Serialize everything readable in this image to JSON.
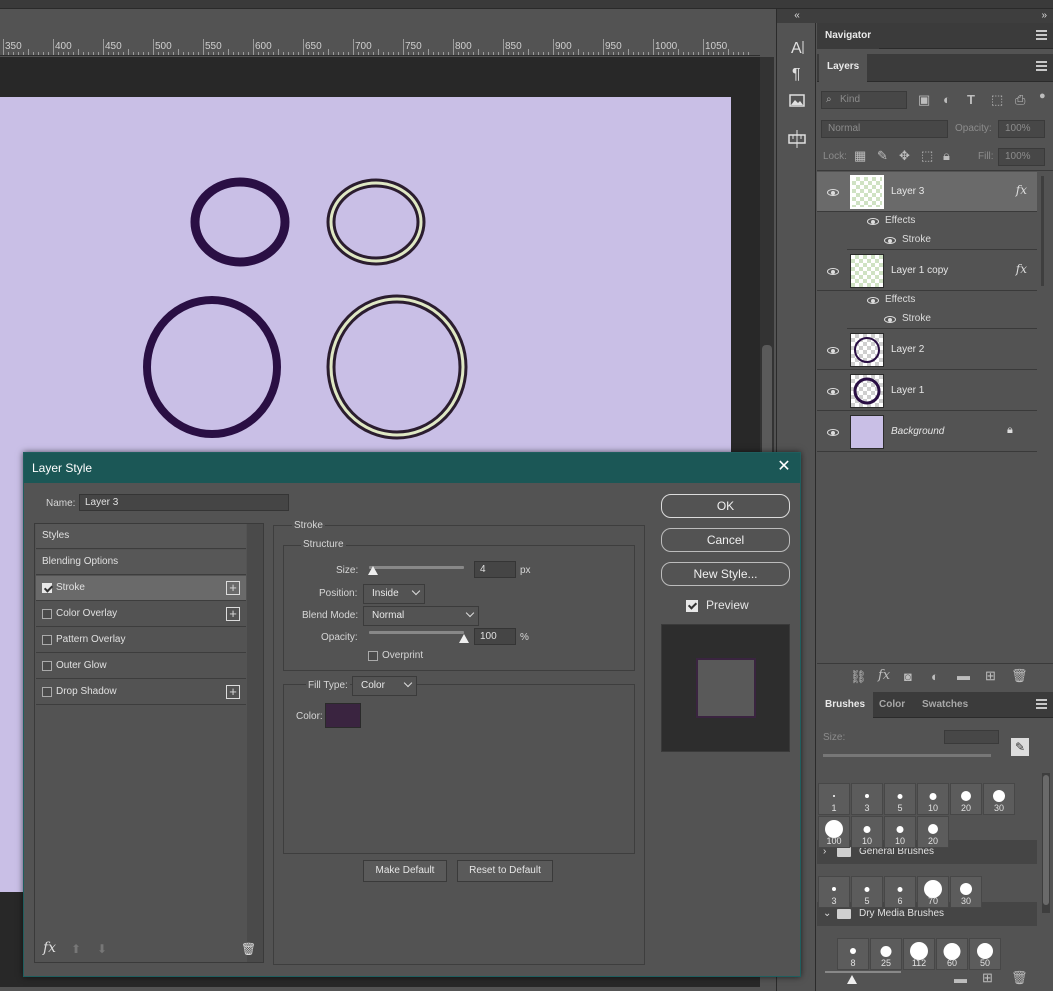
{
  "ruler": {
    "labels": [
      "350",
      "400",
      "450",
      "500",
      "550",
      "600",
      "650",
      "700",
      "750",
      "800",
      "850",
      "900",
      "950",
      "1000",
      "1050"
    ]
  },
  "colors": {
    "canvas": "#c9bfe6",
    "ring_dark": "#2a0f44",
    "ring_light": "#dfe8c4",
    "stroke_color": "#3a2440",
    "dialog_title": "#1b5756"
  },
  "toolbar": {
    "collapse": "«",
    "tools": [
      "character-icon",
      "paragraph-icon",
      "image-icon",
      "measure-icon"
    ]
  },
  "panels": {
    "collapse": "»",
    "navigator_tab": "Navigator",
    "layers_tab": "Layers",
    "filter_kind": "Kind",
    "blend_mode": "Normal",
    "opacity_label": "Opacity:",
    "opacity_value": "100%",
    "lock_label": "Lock:",
    "fill_label": "Fill:",
    "fill_value": "100%"
  },
  "layers": [
    {
      "name": "Layer 3",
      "fx": "fx",
      "effects_label": "Effects",
      "effect": "Stroke",
      "selected": true
    },
    {
      "name": "Layer 1 copy",
      "fx": "fx",
      "effects_label": "Effects",
      "effect": "Stroke",
      "selected": false
    },
    {
      "name": "Layer 2"
    },
    {
      "name": "Layer 1"
    },
    {
      "name": "Background"
    }
  ],
  "brushes_panel": {
    "tabs": [
      "Brushes",
      "Color",
      "Swatches"
    ],
    "size_label": "Size:",
    "row1": [
      "1",
      "3",
      "5",
      "10",
      "20",
      "30"
    ],
    "row2": [
      "100",
      "10",
      "10",
      "20"
    ],
    "group1": "General Brushes",
    "row3": [
      "3",
      "5",
      "6",
      "70",
      "30"
    ],
    "group2": "Dry Media Brushes",
    "row4": [
      "8",
      "25",
      "112",
      "60",
      "50"
    ]
  },
  "dialog": {
    "title": "Layer Style",
    "close": "✕",
    "name_label": "Name:",
    "name_value": "Layer 3",
    "styles": [
      "Styles",
      "Blending Options",
      "Stroke",
      "Color Overlay",
      "Pattern Overlay",
      "Outer Glow",
      "Drop Shadow"
    ],
    "section_title": "Stroke",
    "structure_title": "Structure",
    "size_label": "Size:",
    "size_value": "4",
    "size_unit": "px",
    "size_fraction": 0.04,
    "position_label": "Position:",
    "position_value": "Inside",
    "blend_label": "Blend Mode:",
    "blend_value": "Normal",
    "opacity_label": "Opacity:",
    "opacity_value": "100",
    "opacity_unit": "%",
    "opacity_fraction": 1.0,
    "overprint_label": "Overprint",
    "filltype_label": "Fill Type:",
    "filltype_value": "Color",
    "color_label": "Color:",
    "make_default": "Make Default",
    "reset_default": "Reset to Default",
    "ok": "OK",
    "cancel": "Cancel",
    "new_style": "New Style...",
    "preview_label": "Preview",
    "fx_bottom": "fx"
  }
}
